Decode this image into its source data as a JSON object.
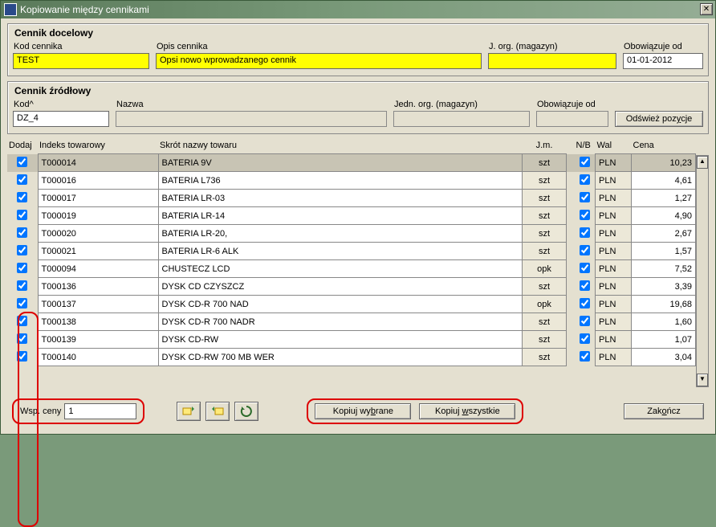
{
  "title": "Kopiowanie między cennikami",
  "target": {
    "group_title": "Cennik docelowy",
    "kod_label": "Kod cennika",
    "kod_value": "TEST",
    "opis_label": "Opis cennika",
    "opis_value": "Opsi nowo wprowadzanego cennik",
    "jorg_label": "J. org. (magazyn)",
    "jorg_value": "",
    "obow_label": "Obowiązuje od",
    "obow_value": "01-01-2012"
  },
  "source": {
    "group_title": "Cennik źródłowy",
    "kod_label": "Kod^",
    "kod_value": "DZ_4",
    "nazwa_label": "Nazwa",
    "nazwa_value": "",
    "jorg_label": "Jedn. org. (magazyn)",
    "jorg_value": "",
    "obow_label": "Obowiązuje od",
    "obow_value": "",
    "refresh_btn": "Odśwież pozycje"
  },
  "headers": {
    "dodaj": "Dodaj",
    "indeks": "Indeks towarowy",
    "skrot": "Skrót nazwy towaru",
    "jm": "J.m.",
    "nb": "N/B",
    "wal": "Wal",
    "cena": "Cena"
  },
  "rows": [
    {
      "idx": "T000014",
      "name": "BATERIA 9V",
      "jm": "szt",
      "wal": "PLN",
      "cena": "10,23"
    },
    {
      "idx": "T000016",
      "name": "BATERIA L736",
      "jm": "szt",
      "wal": "PLN",
      "cena": "4,61"
    },
    {
      "idx": "T000017",
      "name": "BATERIA LR-03",
      "jm": "szt",
      "wal": "PLN",
      "cena": "1,27"
    },
    {
      "idx": "T000019",
      "name": "BATERIA LR-14",
      "jm": "szt",
      "wal": "PLN",
      "cena": "4,90"
    },
    {
      "idx": "T000020",
      "name": "BATERIA LR-20,",
      "jm": "szt",
      "wal": "PLN",
      "cena": "2,67"
    },
    {
      "idx": "T000021",
      "name": "BATERIA LR-6 ALK",
      "jm": "szt",
      "wal": "PLN",
      "cena": "1,57"
    },
    {
      "idx": "T000094",
      "name": "CHUSTECZ  LCD",
      "jm": "opk",
      "wal": "PLN",
      "cena": "7,52"
    },
    {
      "idx": "T000136",
      "name": "DYSK CD CZYSZCZ",
      "jm": "szt",
      "wal": "PLN",
      "cena": "3,39"
    },
    {
      "idx": "T000137",
      "name": "DYSK CD-R 700 NAD",
      "jm": "opk",
      "wal": "PLN",
      "cena": "19,68"
    },
    {
      "idx": "T000138",
      "name": "DYSK CD-R 700 NADR",
      "jm": "szt",
      "wal": "PLN",
      "cena": "1,60"
    },
    {
      "idx": "T000139",
      "name": "DYSK CD-RW",
      "jm": "szt",
      "wal": "PLN",
      "cena": "1,07"
    },
    {
      "idx": "T000140",
      "name": "DYSK CD-RW 700 MB WER",
      "jm": "szt",
      "wal": "PLN",
      "cena": "3,04"
    }
  ],
  "footer": {
    "wsp_label": "Wsp. ceny",
    "wsp_value": "1",
    "kopiuj_wyb": "Kopiuj wybrane",
    "kopiuj_wsz": "Kopiuj wszystkie",
    "zakoncz": "Zakończ"
  },
  "icons": {
    "insert": "insert-row-icon",
    "delete": "delete-row-icon",
    "refresh": "refresh-icon"
  }
}
